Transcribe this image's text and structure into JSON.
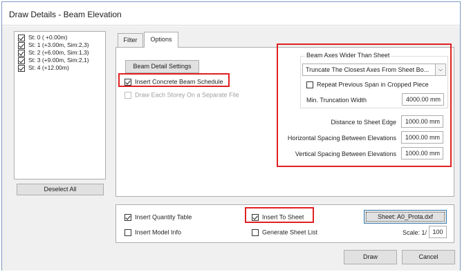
{
  "window": {
    "title": "Draw Details - Beam Elevation"
  },
  "storeys": [
    {
      "label": "St: 0 ( +0.00m)",
      "checked": true
    },
    {
      "label": "St: 1 (+3.00m, Sim:2,3)",
      "checked": true
    },
    {
      "label": "St: 2 (+6.00m, Sim:1,3)",
      "checked": true
    },
    {
      "label": "St: 3 (+9.00m, Sim:2,1)",
      "checked": true
    },
    {
      "label": "St: 4 (+12.00m)",
      "checked": true
    }
  ],
  "deselect_all_label": "Deselect All",
  "tabs": {
    "filter": "Filter",
    "options": "Options",
    "active": "Options"
  },
  "options": {
    "beam_detail_settings_label": "Beam Detail Settings",
    "insert_concrete_beam_schedule": {
      "label": "Insert Concrete Beam Schedule",
      "checked": true
    },
    "draw_each_storey": {
      "label": "Draw Each Storey On a Separate File",
      "checked": false,
      "enabled": false
    },
    "beam_axes_group": {
      "title": "Beam Axes Wider Than Sheet",
      "mode_value": "Truncate The Closest Axes From Sheet Bo...",
      "repeat_previous_span": {
        "label": "Repeat Previous Span in Cropped Piece",
        "checked": false
      },
      "min_truncation_width": {
        "label": "Min. Truncation Width",
        "value": "4000.00 mm"
      }
    },
    "distance_to_sheet_edge": {
      "label": "Distance to Sheet Edge",
      "value": "1000.00 mm"
    },
    "horizontal_spacing": {
      "label": "Horizontal Spacing Between Elevations",
      "value": "1000.00 mm"
    },
    "vertical_spacing": {
      "label": "Vertical Spacing Between Elevations",
      "value": "1000.00 mm"
    }
  },
  "bottom": {
    "insert_quantity_table": {
      "label": "Insert Quantity Table",
      "checked": true
    },
    "insert_model_info": {
      "label": "Insert Model Info",
      "checked": false
    },
    "insert_to_sheet": {
      "label": "Insert To Sheet",
      "checked": true
    },
    "generate_sheet_list": {
      "label": "Generate Sheet List",
      "checked": false
    },
    "sheet_button_label": "Sheet: A0_Prota.dxf",
    "scale_label": "Scale: 1/",
    "scale_value": "100"
  },
  "footer": {
    "draw_label": "Draw",
    "cancel_label": "Cancel"
  },
  "colors": {
    "highlight_box": "#e02020",
    "focus_border": "#3c7fb1"
  }
}
